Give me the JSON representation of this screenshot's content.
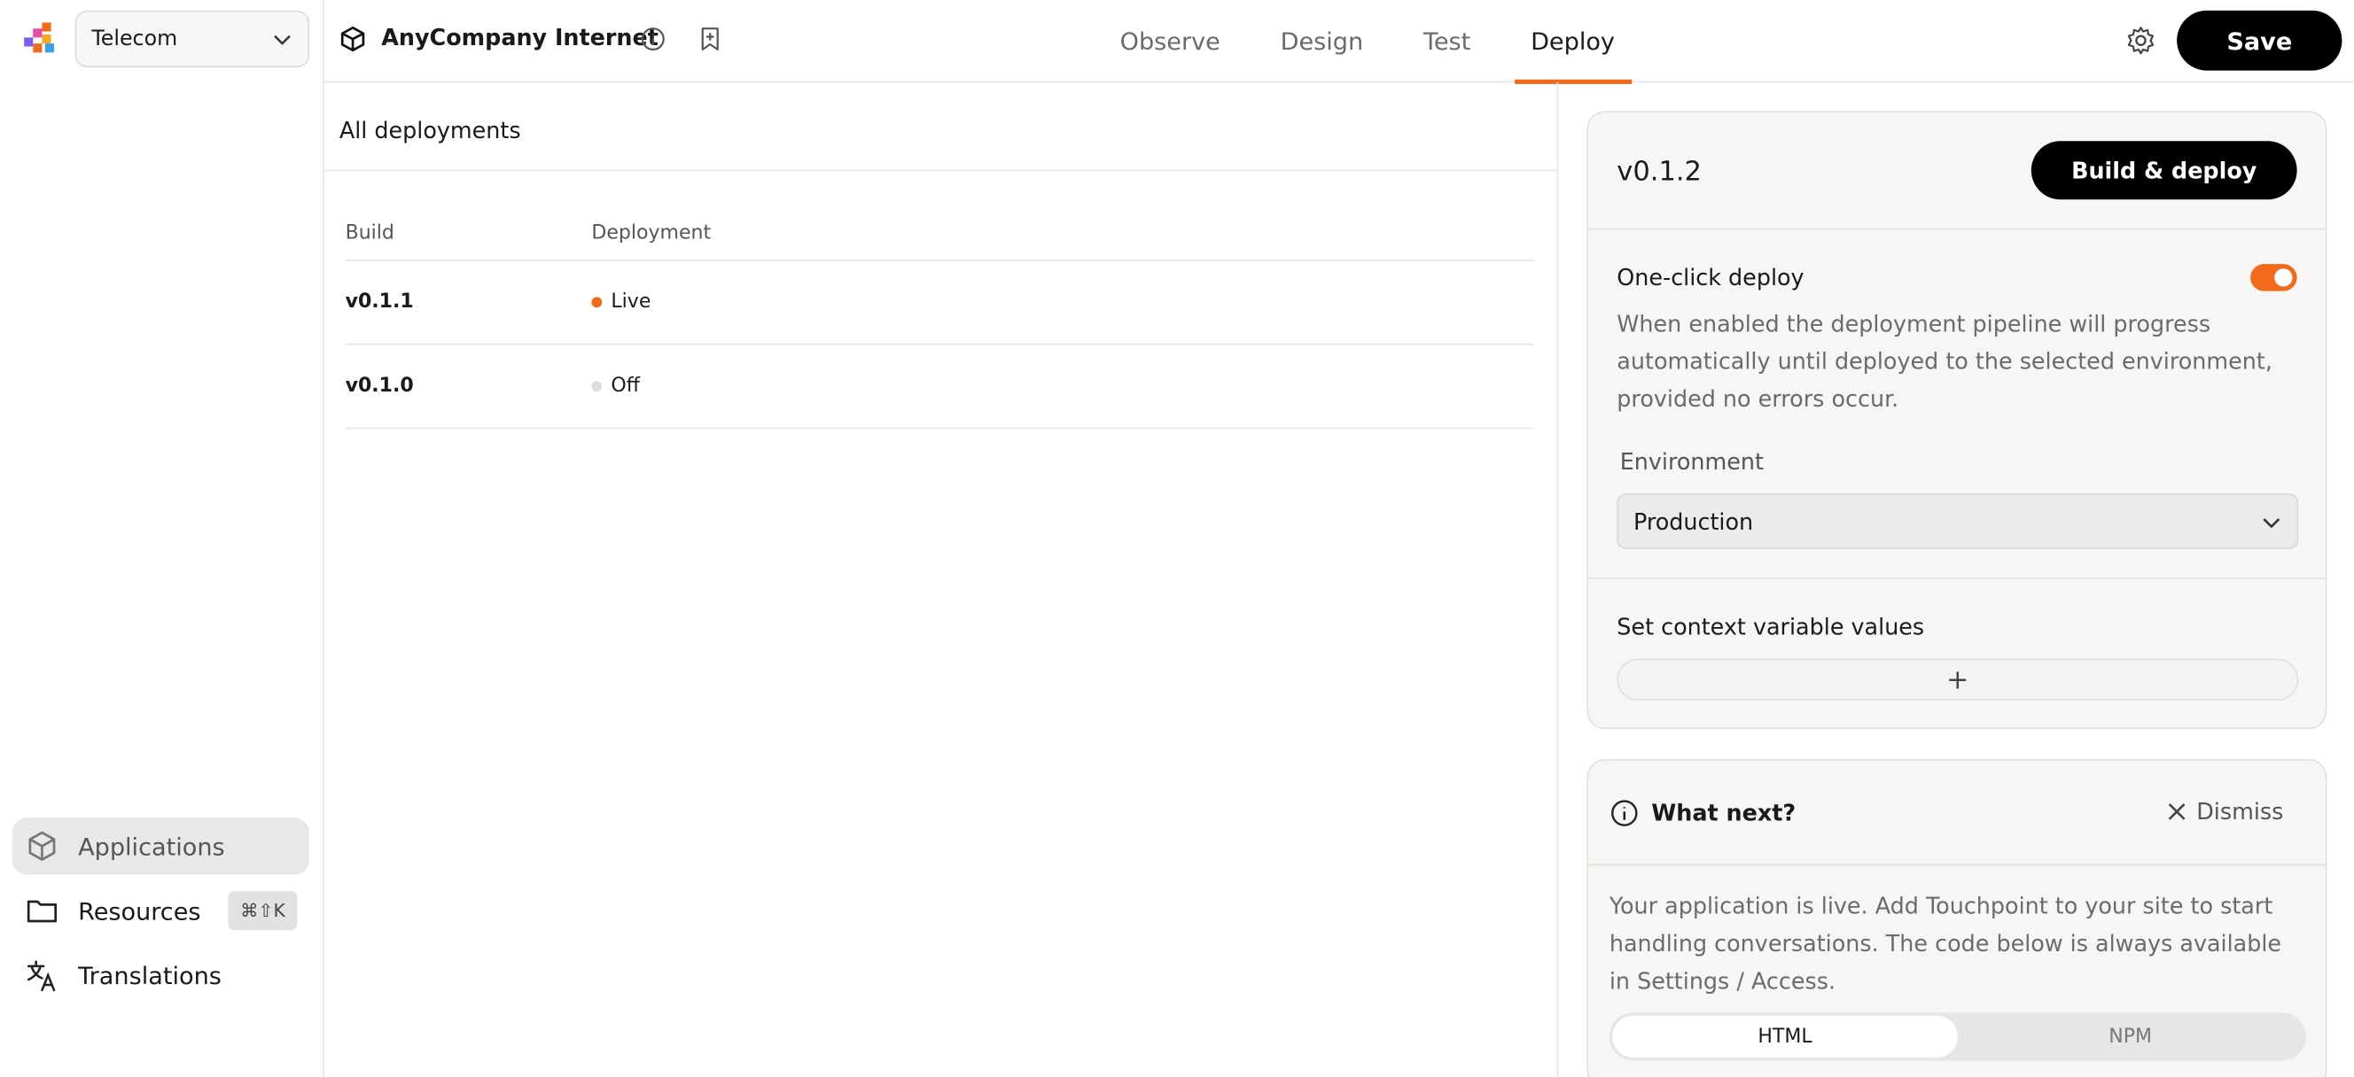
{
  "workspace": {
    "name": "Telecom"
  },
  "sidebar": {
    "items": [
      {
        "label": "Applications",
        "icon": "cube-icon",
        "active": true
      },
      {
        "label": "Resources",
        "icon": "folder-icon",
        "shortcut": "⌘⇧K"
      },
      {
        "label": "Translations",
        "icon": "translate-icon"
      }
    ]
  },
  "header": {
    "app_title": "AnyCompany Internet",
    "tabs": [
      {
        "label": "Observe"
      },
      {
        "label": "Design"
      },
      {
        "label": "Test"
      },
      {
        "label": "Deploy",
        "active": true
      }
    ],
    "save_label": "Save"
  },
  "main": {
    "title": "All deployments",
    "columns": [
      "Build",
      "Deployment"
    ],
    "rows": [
      {
        "build": "v0.1.1",
        "status": "Live",
        "dot_color": "#f26b1d"
      },
      {
        "build": "v0.1.0",
        "status": "Off",
        "dot_color": "#dddddd"
      }
    ]
  },
  "panel": {
    "version": "v0.1.2",
    "build_label": "Build & deploy",
    "one_click_title": "One-click deploy",
    "one_click_enabled": true,
    "one_click_desc": "When enabled the deployment pipeline will progress automatically until deployed to the selected environment, provided no errors occur.",
    "env_label": "Environment",
    "env_value": "Production",
    "ctx_title": "Set context variable values",
    "add_symbol": "+"
  },
  "whatnext": {
    "title": "What next?",
    "dismiss_label": "Dismiss",
    "desc": "Your application is live. Add Touchpoint to your site to start handling conversations. The code below is always available in Settings / Access.",
    "segments": [
      "HTML",
      "NPM"
    ],
    "selected_segment": "HTML"
  },
  "colors": {
    "accent": "#f26b1d",
    "primary_button": "#000000"
  }
}
